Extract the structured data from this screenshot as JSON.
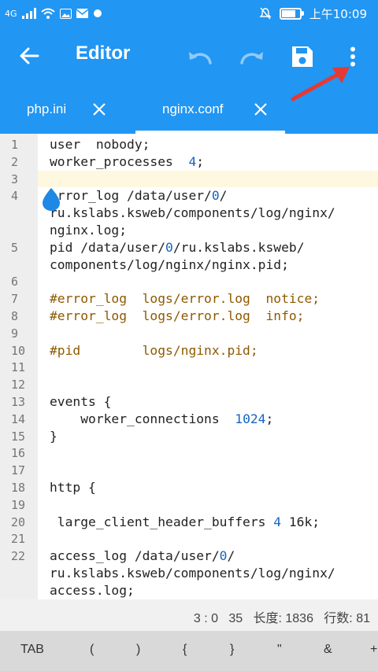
{
  "status_bar": {
    "network": "4G",
    "time": "上午10:09"
  },
  "toolbar": {
    "title": "Editor"
  },
  "tabs": [
    {
      "label": "php.ini",
      "active": false
    },
    {
      "label": "nginx.conf",
      "active": true
    }
  ],
  "editor": {
    "lines": [
      {
        "num": "1",
        "text": "user  nobody;"
      },
      {
        "num": "2",
        "text": "worker_processes  4;"
      },
      {
        "num": "3",
        "text": ""
      },
      {
        "num": "4",
        "text": "error_log /data/user/0/"
      },
      {
        "num": "",
        "text": "ru.kslabs.ksweb/components/log/nginx/"
      },
      {
        "num": "",
        "text": "nginx.log;"
      },
      {
        "num": "5",
        "text": "pid /data/user/0/ru.kslabs.ksweb/"
      },
      {
        "num": "",
        "text": "components/log/nginx/nginx.pid;"
      },
      {
        "num": "6",
        "text": ""
      },
      {
        "num": "7",
        "text": "#error_log  logs/error.log  notice;"
      },
      {
        "num": "8",
        "text": "#error_log  logs/error.log  info;"
      },
      {
        "num": "9",
        "text": ""
      },
      {
        "num": "10",
        "text": "#pid        logs/nginx.pid;"
      },
      {
        "num": "11",
        "text": ""
      },
      {
        "num": "12",
        "text": ""
      },
      {
        "num": "13",
        "text": "events {"
      },
      {
        "num": "14",
        "text": "    worker_connections  1024;"
      },
      {
        "num": "15",
        "text": "}"
      },
      {
        "num": "16",
        "text": ""
      },
      {
        "num": "17",
        "text": ""
      },
      {
        "num": "18",
        "text": "http {"
      },
      {
        "num": "19",
        "text": ""
      },
      {
        "num": "20",
        "text": " large_client_header_buffers 4 16k;"
      },
      {
        "num": "21",
        "text": ""
      },
      {
        "num": "22",
        "text": "access_log /data/user/0/"
      },
      {
        "num": "",
        "text": "ru.kslabs.ksweb/components/log/nginx/"
      },
      {
        "num": "",
        "text": "access.log;"
      }
    ]
  },
  "footer": {
    "status": "3 : 0   35   长度: 1836   行数: 81"
  },
  "symbols": [
    "TAB",
    "(",
    ")",
    "{",
    "}",
    "\"",
    "&",
    "+"
  ],
  "colors": {
    "primary": "#2196f3",
    "number": "#1565c0",
    "comment": "#8d5a00",
    "arrow": "#e53935"
  }
}
